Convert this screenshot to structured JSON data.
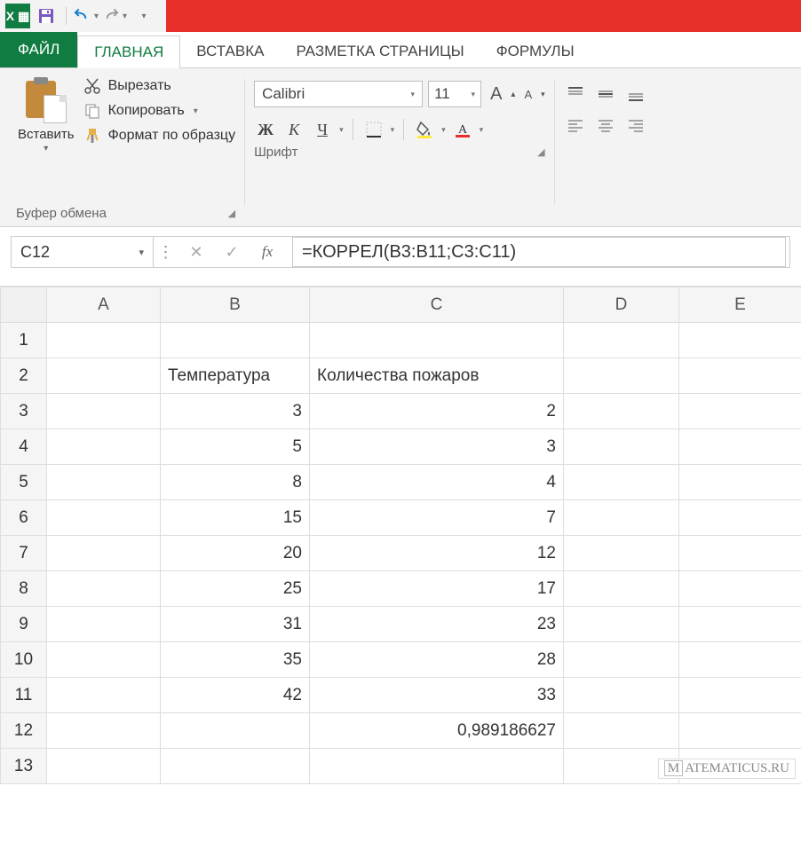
{
  "qat": {
    "undo": "↶",
    "redo": "↷"
  },
  "tabs": {
    "file": "ФАЙЛ",
    "home": "ГЛАВНАЯ",
    "insert": "ВСТАВКА",
    "layout": "РАЗМЕТКА СТРАНИЦЫ",
    "formulas": "ФОРМУЛЫ"
  },
  "clipboard": {
    "paste": "Вставить",
    "cut": "Вырезать",
    "copy": "Копировать",
    "format_painter": "Формат по образцу",
    "group_label": "Буфер обмена"
  },
  "font": {
    "name": "Calibri",
    "size": "11",
    "bold": "Ж",
    "italic": "К",
    "underline": "Ч",
    "grow": "A",
    "shrink": "A",
    "colorA": "A",
    "group_label": "Шрифт"
  },
  "namebox": "C12",
  "fx_label": "fx",
  "formula": "=КОРРЕЛ(B3:B11;C3:C11)",
  "columns": [
    "A",
    "B",
    "C",
    "D",
    "E"
  ],
  "rows": [
    {
      "n": "1",
      "A": "",
      "B": "",
      "C": "",
      "D": "",
      "E": ""
    },
    {
      "n": "2",
      "A": "",
      "B": "Температура",
      "C": "Количества пожаров",
      "D": "",
      "E": ""
    },
    {
      "n": "3",
      "A": "",
      "B": "3",
      "C": "2",
      "D": "",
      "E": ""
    },
    {
      "n": "4",
      "A": "",
      "B": "5",
      "C": "3",
      "D": "",
      "E": ""
    },
    {
      "n": "5",
      "A": "",
      "B": "8",
      "C": "4",
      "D": "",
      "E": ""
    },
    {
      "n": "6",
      "A": "",
      "B": "15",
      "C": "7",
      "D": "",
      "E": ""
    },
    {
      "n": "7",
      "A": "",
      "B": "20",
      "C": "12",
      "D": "",
      "E": ""
    },
    {
      "n": "8",
      "A": "",
      "B": "25",
      "C": "17",
      "D": "",
      "E": ""
    },
    {
      "n": "9",
      "A": "",
      "B": "31",
      "C": "23",
      "D": "",
      "E": ""
    },
    {
      "n": "10",
      "A": "",
      "B": "35",
      "C": "28",
      "D": "",
      "E": ""
    },
    {
      "n": "11",
      "A": "",
      "B": "42",
      "C": "33",
      "D": "",
      "E": ""
    },
    {
      "n": "12",
      "A": "",
      "B": "",
      "C": "0,989186627",
      "D": "",
      "E": ""
    },
    {
      "n": "13",
      "A": "",
      "B": "",
      "C": "",
      "D": "",
      "E": ""
    }
  ],
  "watermark": {
    "M": "M",
    "rest": "ATEMATICUS.RU"
  }
}
